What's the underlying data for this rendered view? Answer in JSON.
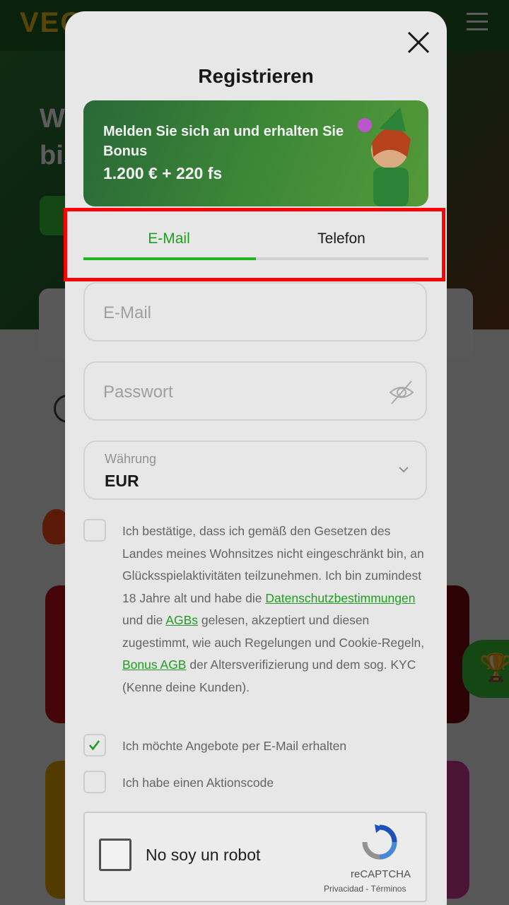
{
  "background": {
    "hero_text": "W\nbis",
    "menu_icon": "hamburger-icon"
  },
  "modal": {
    "title": "Registrieren",
    "close_icon": "close-icon",
    "promo": {
      "line1": "Melden Sie sich an und erhalten Sie Bonus",
      "line2": "1.200 € + 220 fs"
    },
    "tabs": [
      {
        "label": "E-Mail",
        "active": true
      },
      {
        "label": "Telefon",
        "active": false
      }
    ],
    "email_field": {
      "placeholder": "E-Mail",
      "value": ""
    },
    "password_field": {
      "placeholder": "Passwort",
      "value": "",
      "icon": "eye-off-icon"
    },
    "currency_field": {
      "label": "Währung",
      "value": "EUR",
      "icon": "chevron-down-icon"
    },
    "terms": {
      "text_1": "Ich bestätige, dass ich gemäß den Gesetzen des Landes meines Wohnsitzes nicht eingeschränkt bin, an Glücksspielaktivitäten teilzunehmen. Ich bin zumindest 18 Jahre alt und habe die ",
      "link_privacy": "Datenschutzbestimmungen",
      "text_2": " und die ",
      "link_agb": "AGBs",
      "text_3": " gelesen, akzeptiert und diesen zugestimmt, wie auch Regelungen und Cookie-Regeln, ",
      "link_bonus": "Bonus AGB",
      "text_4": " der Altersverifizierung und dem sog. KYC (Kenne deine Kunden).",
      "checked": false
    },
    "offers": {
      "label": "Ich möchte Angebote per E-Mail erhalten",
      "checked": true
    },
    "promo_code": {
      "label": "Ich habe einen Aktionscode",
      "checked": false
    },
    "recaptcha": {
      "label": "No soy un robot",
      "brand": "reCAPTCHA",
      "terms": "Privacidad - Términos"
    }
  },
  "colors": {
    "accent_green": "#23a623",
    "highlight_red": "#ff0000"
  }
}
